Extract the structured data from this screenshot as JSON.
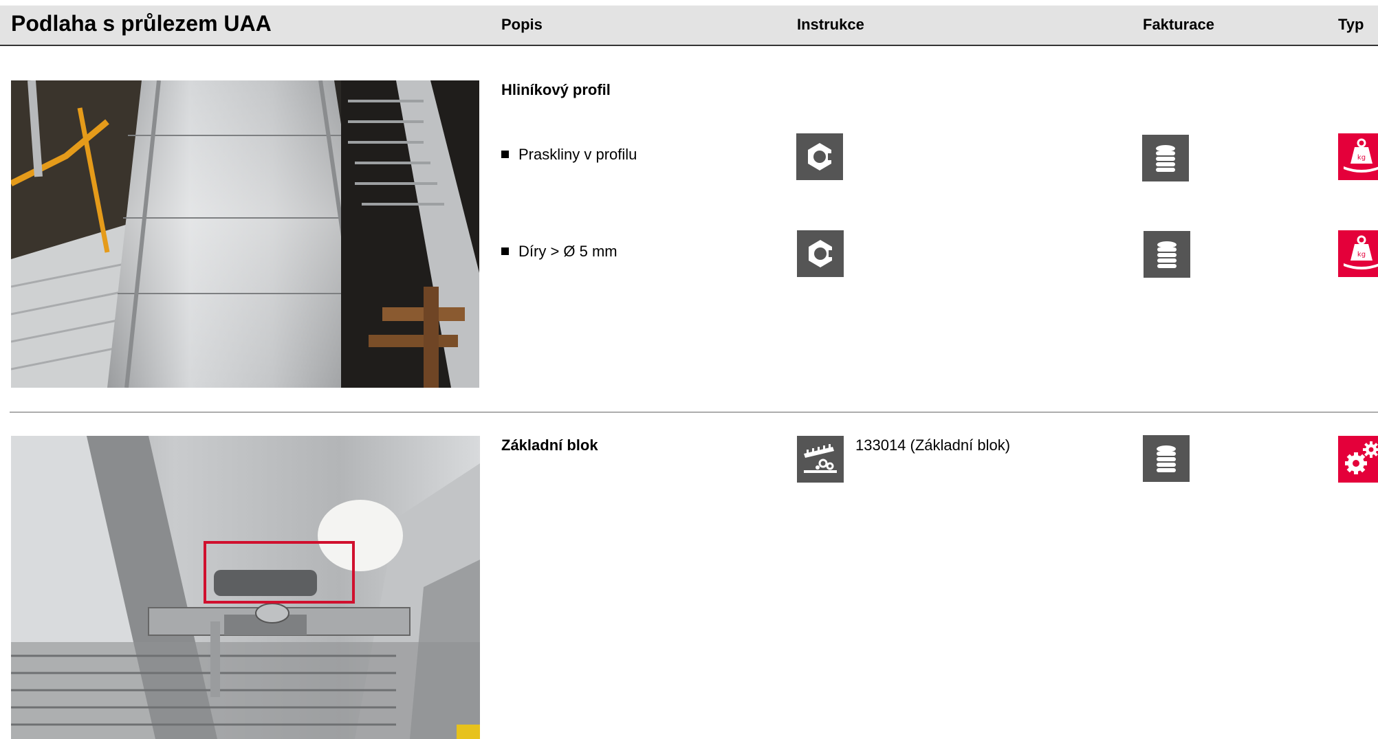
{
  "header": {
    "title": "Podlaha s průlezem UAA",
    "columns": {
      "popis": "Popis",
      "instrukce": "Instrukce",
      "fakturace": "Fakturace",
      "typ": "Typ"
    }
  },
  "sections": [
    {
      "title": "Hliníkový profil",
      "items": [
        {
          "text": "Praskliny v profilu",
          "instruction_icon": "nut-icon",
          "billing_icon": "coin-stack-icon",
          "type_icon": "weight-kg-icon"
        },
        {
          "text": "Díry > Ø 5 mm",
          "instruction_icon": "nut-icon",
          "billing_icon": "coin-stack-icon",
          "type_icon": "weight-kg-icon"
        }
      ]
    },
    {
      "title": "Základní blok",
      "instruction_icon": "repair-tool-icon",
      "reference": "133014 (Základní blok)",
      "billing_icon": "coin-stack-icon",
      "type_icon": "gears-icon"
    }
  ],
  "colors": {
    "icon_gray": "#555555",
    "icon_red": "#e4003a",
    "header_bg": "#e3e3e3",
    "highlight_box": "#d0102e"
  }
}
